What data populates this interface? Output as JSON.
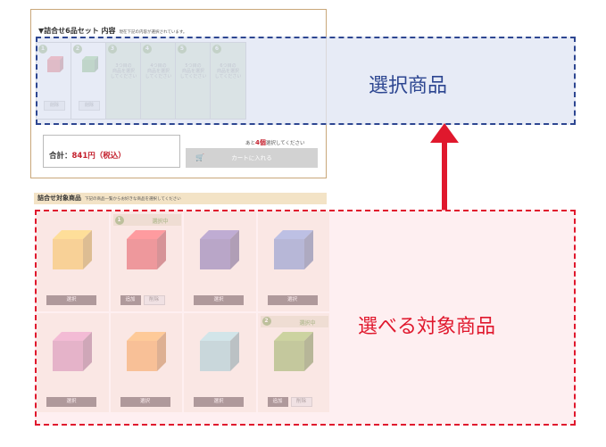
{
  "header": {
    "title": "▼詰合せ6品セット 内容",
    "subtitle": "現在下記の内容が選択されています。"
  },
  "slots": [
    {
      "num": "1",
      "state": "filled",
      "color": "#d8262c",
      "remove_label": "削除"
    },
    {
      "num": "2",
      "state": "filled",
      "color": "#4f9a3a",
      "remove_label": "削除"
    },
    {
      "num": "3",
      "state": "empty",
      "text": "3つ目の\n商品を選択\nしてください"
    },
    {
      "num": "4",
      "state": "empty",
      "text": "4つ目の\n商品を選択\nしてください"
    },
    {
      "num": "5",
      "state": "empty",
      "text": "5つ目の\n商品を選択\nしてください"
    },
    {
      "num": "6",
      "state": "empty",
      "text": "6つ目の\n商品を選択\nしてください"
    }
  ],
  "total": {
    "label": "合計：",
    "value": "841円（税込）"
  },
  "remain": {
    "prefix": "あと",
    "count": "4個",
    "suffix": "選択してください"
  },
  "cart_button": {
    "label": "カートに入れる",
    "icon": "cart-icon"
  },
  "callouts": {
    "selected": "選択商品",
    "targets": "選べる対象商品"
  },
  "target_section": {
    "title": "詰合せ対象商品",
    "subtitle": "下記の商品一覧からお好きな商品を選択してください"
  },
  "products": [
    {
      "color": "#f0b41e",
      "select_label": "選択"
    },
    {
      "color": "#d8262c",
      "selected": true,
      "badge_num": "1",
      "badge_label": "選択中",
      "add_label": "追加",
      "remove_label": "削除"
    },
    {
      "color": "#544a98",
      "select_label": "選択"
    },
    {
      "color": "#4f74bd",
      "select_label": "選択"
    },
    {
      "color": "#c06a9c",
      "select_label": "選択"
    },
    {
      "color": "#ef8a1f",
      "select_label": "選択"
    },
    {
      "color": "#7cc4c8",
      "select_label": "選択"
    },
    {
      "color": "#6e9e2e",
      "selected": true,
      "badge_num": "2",
      "badge_label": "選択中",
      "add_label": "追加",
      "remove_label": "削除"
    }
  ],
  "colors": {
    "selected_frame": "#2d4691",
    "targets_frame": "#e0182d",
    "accent_green": "#5c8a2c",
    "price_red": "#c4212e"
  }
}
